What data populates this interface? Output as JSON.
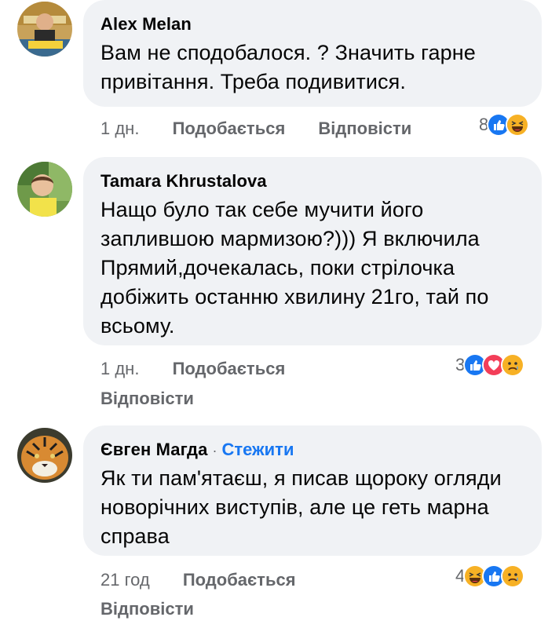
{
  "comments": [
    {
      "author": "Alex Melan",
      "text": "Вам не сподобалося. ? Значить гарне привітання. Треба подивитися.",
      "time": "1 дн.",
      "like_label": "Подобається",
      "reply_label": "Відповісти",
      "reaction_count": "8",
      "reactions": [
        "like-icon",
        "haha-icon"
      ]
    },
    {
      "author": "Tamara Khrustalova",
      "text": "Нащо було так себе мучити його заплившою мармизою?))) Я включила Прямий,дочекалась, поки стрілочка добіжить останню хвилину 21го, тай по всьому.",
      "time": "1 дн.",
      "like_label": "Подобається",
      "reply_label": "Відповісти",
      "reaction_count": "3",
      "reactions": [
        "like-icon",
        "love-icon",
        "sad-icon"
      ]
    },
    {
      "author": "Євген Магда",
      "separator": "·",
      "follow_label": "Стежити",
      "text": "Як ти пам'ятаєш, я писав щороку огляди новорічних виступів, але це геть марна справа",
      "time": "21 год",
      "like_label": "Подобається",
      "reply_label": "Відповісти",
      "reaction_count": "4",
      "reactions": [
        "haha-icon",
        "like-icon",
        "sad-icon"
      ]
    }
  ],
  "colors": {
    "bubble": "#f0f2f5",
    "secondary_text": "#65676b",
    "link_blue": "#1877f2",
    "like_blue": "#1877f2",
    "love_red": "#f33e58",
    "emoji_yellow": "#f7b125"
  }
}
